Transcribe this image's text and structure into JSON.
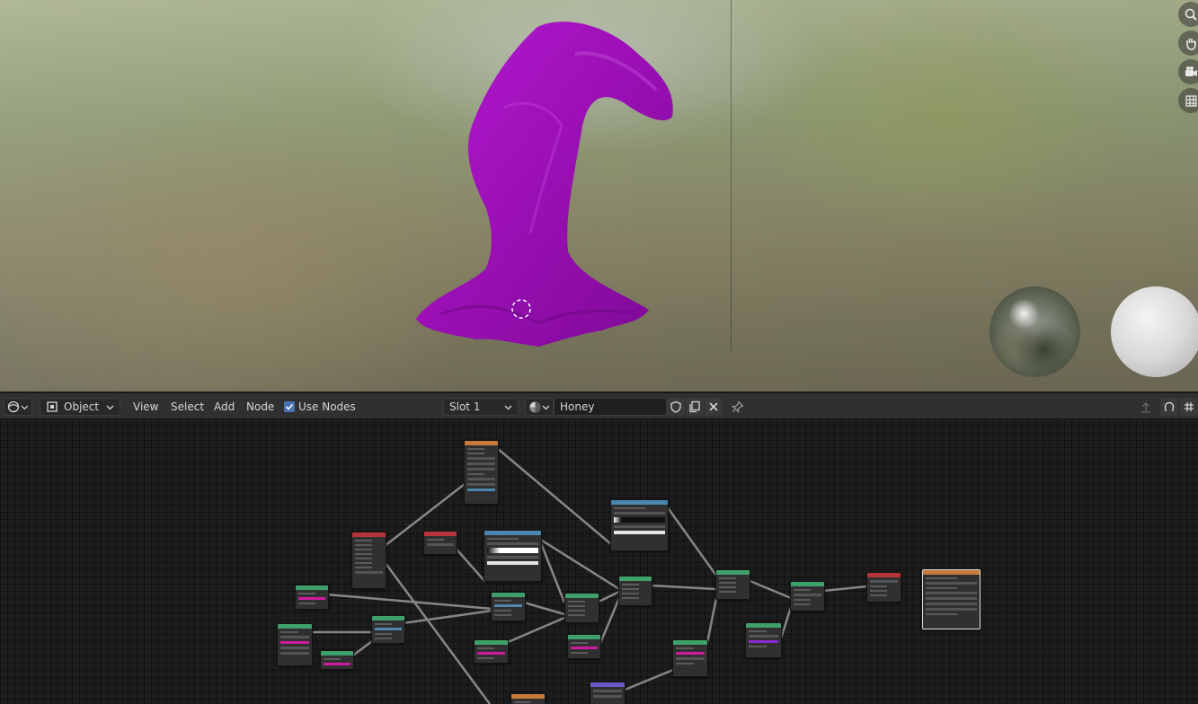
{
  "header": {
    "editor_type_icon": "shader-editor-icon",
    "mode": "Object",
    "menus": [
      "View",
      "Select",
      "Add",
      "Node"
    ],
    "use_nodes_label": "Use Nodes",
    "use_nodes_checked": true,
    "slot": "Slot 1",
    "material_icon": "material-sphere-icon",
    "material_name": "Honey",
    "material_actions": [
      "fake-user-icon",
      "duplicate-material-icon",
      "unlink-icon"
    ],
    "pin_icon": "pin-icon",
    "right_icons": [
      "parent-node-tree-icon",
      "snap-icon",
      "snap-increment-icon"
    ]
  },
  "viewport": {
    "navigation_icons": [
      "zoom-icon",
      "pan-hand-icon",
      "camera-view-icon",
      "orthographic-grid-icon"
    ],
    "object_color": "#a010b8",
    "lookdev_spheres": [
      "hdri-chrome-sphere",
      "diffuse-sphere"
    ]
  },
  "node_editor": {
    "header_colors": {
      "shader": "#3fa06a",
      "texture": "#c87a3a",
      "converter": "#4a86ad",
      "input": "#b8343c",
      "vector": "#6a5acb",
      "output": "#b8343c"
    }
  }
}
